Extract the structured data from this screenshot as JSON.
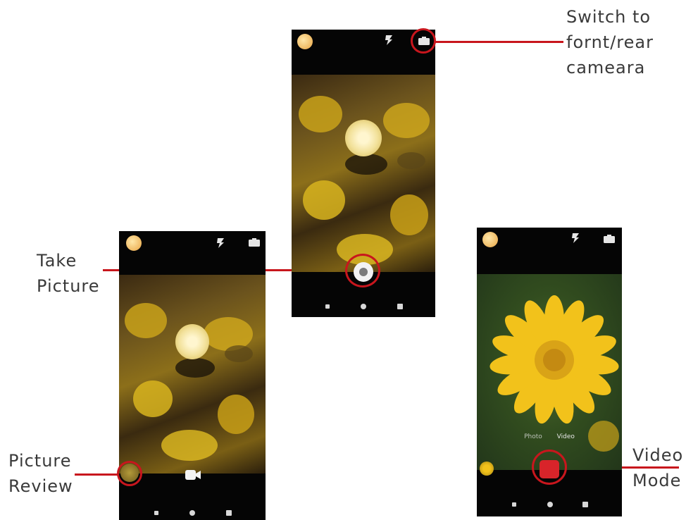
{
  "annotations": {
    "switch_camera": {
      "lines": [
        "Switch to",
        "fornt/rear",
        "cameara"
      ]
    },
    "take_picture": {
      "lines": [
        "Take",
        "Picture"
      ]
    },
    "picture_review": {
      "lines": [
        "Picture",
        "Review"
      ]
    },
    "video_mode": {
      "lines": [
        "Video",
        "Mode"
      ]
    }
  },
  "video_screen": {
    "mode_labels": [
      "Photo",
      "Video"
    ]
  },
  "icons": {
    "settings": "settings-icon",
    "flash": "flash-icon",
    "switch_camera": "switch-camera-icon",
    "shutter": "shutter-icon",
    "video_toggle": "video-camera-icon",
    "record": "record-icon",
    "thumbnail": "thumbnail-icon",
    "nav_back": "back-icon",
    "nav_home": "home-icon",
    "nav_recents": "recents-icon"
  },
  "colors": {
    "annotation": "#c8161d",
    "label_text": "#3a3a3a",
    "flower_yellow": "#f2c21b",
    "record_red": "#d8242a"
  }
}
